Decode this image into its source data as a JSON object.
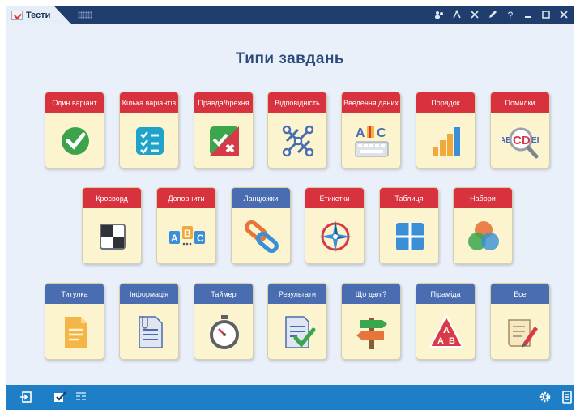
{
  "topbar": {
    "tab_label": "Тести",
    "icons": [
      "users-icon",
      "connect-icon",
      "tools-icon",
      "pen-icon",
      "help-icon",
      "minimize-icon",
      "maximize-icon",
      "close-icon"
    ],
    "help_glyph": "?"
  },
  "main": {
    "title": "Типи завдань",
    "rows": [
      [
        {
          "label": "Один варіант",
          "icon": "single-choice-check-icon"
        },
        {
          "label": "Кілька варіантів",
          "icon": "multiple-choice-list-icon"
        },
        {
          "label": "Правда/брехня",
          "icon": "true-false-icon"
        },
        {
          "label": "Відповідність",
          "icon": "matching-icon"
        },
        {
          "label": "Введення даних",
          "icon": "keyboard-input-icon",
          "letters": [
            "A",
            "C"
          ]
        },
        {
          "label": "Порядок",
          "icon": "ordering-bars-icon"
        },
        {
          "label": "Помилки",
          "icon": "magnifier-errors-icon",
          "letters": [
            "AB",
            "CD",
            "EF"
          ]
        }
      ],
      [
        {
          "label": "Кросворд",
          "icon": "crossword-icon"
        },
        {
          "label": "Доповнити",
          "icon": "fill-in-letters-icon",
          "letters": [
            "A",
            "B",
            "C"
          ]
        },
        {
          "label": "Ланцюжки",
          "icon": "chain-links-icon"
        },
        {
          "label": "Етикетки",
          "icon": "compass-labels-icon"
        },
        {
          "label": "Таблиця",
          "icon": "table-grid-icon"
        },
        {
          "label": "Набори",
          "icon": "venn-sets-icon"
        }
      ],
      [
        {
          "label": "Титулка",
          "icon": "title-page-icon"
        },
        {
          "label": "Інформація",
          "icon": "information-document-icon"
        },
        {
          "label": "Таймер",
          "icon": "stopwatch-icon"
        },
        {
          "label": "Результати",
          "icon": "results-checklist-icon"
        },
        {
          "label": "Що далі?",
          "icon": "signpost-icon"
        },
        {
          "label": "Піраміда",
          "icon": "pyramid-icon",
          "letters": [
            "A",
            "A",
            "B"
          ]
        },
        {
          "label": "Есе",
          "icon": "essay-scroll-icon"
        }
      ]
    ]
  },
  "bottombar": {
    "icons": [
      "exit-icon",
      "test-check-icon",
      "layout-icon",
      "settings-gear-icon",
      "document-list-icon"
    ]
  },
  "colors": {
    "topbar": "#1f3e6e",
    "background": "#e9f0fa",
    "card": "#fbf4cf",
    "red_header": "#d8323e",
    "blue_header": "#4a6cb0",
    "bottombar": "#1e7fc7"
  }
}
